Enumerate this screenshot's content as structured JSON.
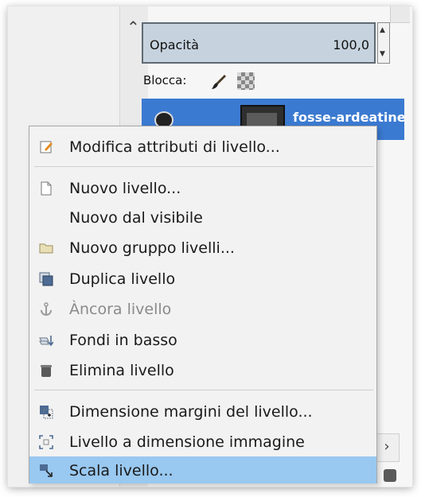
{
  "layers_panel": {
    "opacity_label": "Opacità",
    "opacity_value": "100,0",
    "lock_label": "Blocca:",
    "layer_name": "fosse-ardeatine"
  },
  "context_menu": {
    "items": [
      {
        "label": "Modifica attributi di livello...",
        "icon": "edit-attributes-icon",
        "disabled": false
      },
      {
        "label": "Nuovo livello...",
        "icon": "new-layer-icon",
        "disabled": false
      },
      {
        "label": "Nuovo dal visibile",
        "icon": "",
        "disabled": false
      },
      {
        "label": "Nuovo gruppo livelli...",
        "icon": "folder-icon",
        "disabled": false
      },
      {
        "label": "Duplica livello",
        "icon": "duplicate-icon",
        "disabled": false
      },
      {
        "label": "Àncora livello",
        "icon": "anchor-icon",
        "disabled": true
      },
      {
        "label": "Fondi in basso",
        "icon": "merge-down-icon",
        "disabled": false
      },
      {
        "label": "Elimina livello",
        "icon": "trash-icon",
        "disabled": false
      },
      {
        "label": "Dimensione margini del livello...",
        "icon": "layer-boundary-icon",
        "disabled": false
      },
      {
        "label": "Livello a dimensione immagine",
        "icon": "layer-to-image-size-icon",
        "disabled": false
      },
      {
        "label": "Scala livello...",
        "icon": "scale-layer-icon",
        "disabled": false,
        "selected": true
      }
    ]
  },
  "colors": {
    "selection_highlight": "#99c8f0",
    "layer_selected": "#3b7ad1",
    "opacity_field": "#c6d3de"
  }
}
